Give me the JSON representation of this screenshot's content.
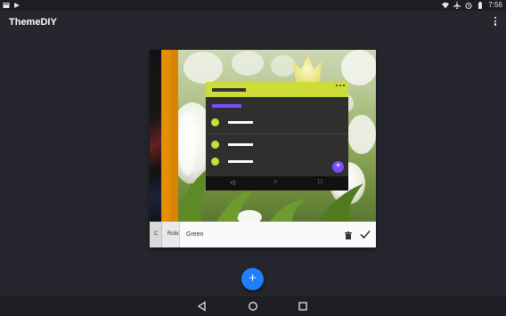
{
  "app": {
    "title": "ThemeDIY"
  },
  "statusbar": {
    "time": "7:56",
    "icons": [
      "notification-icon",
      "play-store-icon",
      "wifi-icon",
      "airplane-icon",
      "alarm-icon",
      "battery-icon"
    ]
  },
  "card": {
    "tabs": [
      {
        "label": "C",
        "selected": false
      },
      {
        "label": "Robo",
        "selected": false
      },
      {
        "label": "Green",
        "selected": true
      }
    ],
    "colors": {
      "accent": "#cddc39",
      "secondary": "#7c4dff",
      "stripe": "#e48f00"
    }
  },
  "colors": {
    "background": "#26272e",
    "bars": "#1d1e24",
    "fab": "#1e80ff"
  }
}
